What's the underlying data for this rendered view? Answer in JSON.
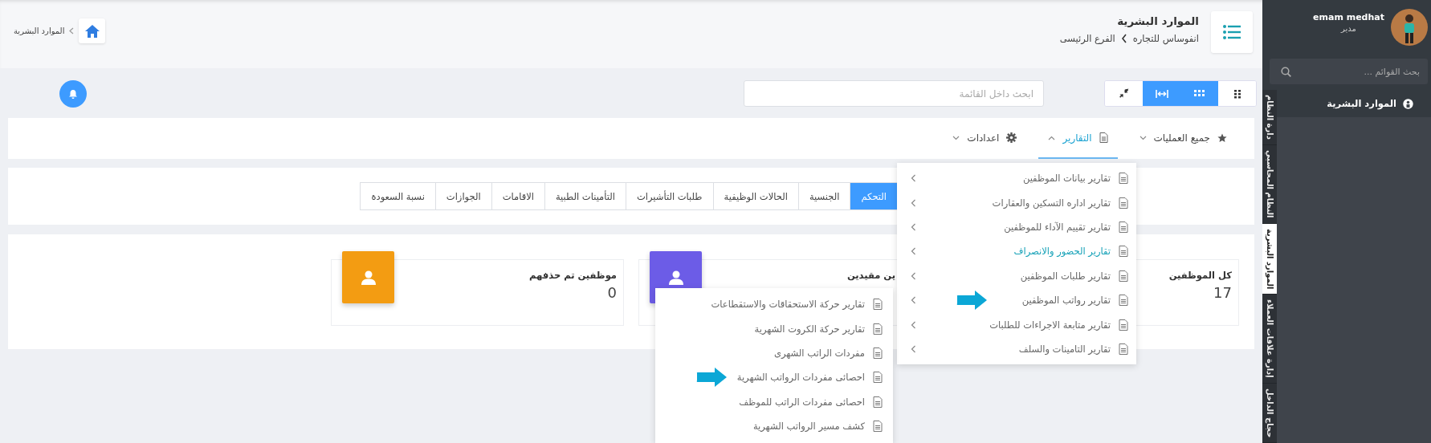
{
  "header": {
    "title": "الموارد البشرية",
    "breadcrumb": [
      "انفوساس للتجاره",
      "الفرع الرئيسى"
    ],
    "home_crumb": "الموارد البشرية"
  },
  "toolbar": {
    "search": {
      "placeholder": "ابحث داخل القائمة"
    },
    "view_buttons": [
      {
        "kind": "grid",
        "selected": false
      },
      {
        "kind": "tiles",
        "selected": true
      },
      {
        "kind": "expand",
        "selected": true
      },
      {
        "kind": "compress",
        "selected": false
      }
    ]
  },
  "menu_bar": [
    {
      "label": "جميع العمليات",
      "kind": "star",
      "selected": false,
      "expanded": false
    },
    {
      "label": "التقارير",
      "kind": "document",
      "selected": true,
      "expanded": true
    },
    {
      "label": "اعدادات",
      "kind": "gear",
      "selected": false,
      "expanded": false
    }
  ],
  "tabs": [
    {
      "label": "التحكم",
      "selected": true
    },
    {
      "label": "الجنسية",
      "selected": false
    },
    {
      "label": "الحالات الوظيفية",
      "selected": false
    },
    {
      "label": "طلبات التأشيرات",
      "selected": false
    },
    {
      "label": "التأمينات الطبية",
      "selected": false
    },
    {
      "label": "الاقامات",
      "selected": false
    },
    {
      "label": "الجوازات",
      "selected": false
    },
    {
      "label": "نسبة السعودة",
      "selected": false
    }
  ],
  "stats": [
    {
      "label": "كل الموظفين",
      "value": "17"
    },
    {
      "label": "ين مقيدين",
      "color": "#6c5ce7"
    },
    {
      "label": "موظفين تم حذفهم",
      "value": "0",
      "color": "#f39c12"
    }
  ],
  "reports_menu": {
    "items": [
      {
        "label": "تقارير بيانات الموظفين",
        "selected": false,
        "marked": false
      },
      {
        "label": "تقارير اداره التسكين والعقارات",
        "selected": false,
        "marked": false
      },
      {
        "label": "تقارير تقييم الآداء للموظفين",
        "selected": false,
        "marked": false
      },
      {
        "label": "تقارير الحضور والانصراف",
        "selected": true,
        "marked": false
      },
      {
        "label": "تقارير طلبات الموظفين",
        "selected": false,
        "marked": false
      },
      {
        "label": "تقارير رواتب الموظفين",
        "selected": false,
        "marked": true
      },
      {
        "label": "تقارير متابعة الاجراءات للطلبات",
        "selected": false,
        "marked": false
      },
      {
        "label": "تقارير التامينات والسلف",
        "selected": false,
        "marked": false
      }
    ]
  },
  "salary_submenu": {
    "items": [
      {
        "label": "تقارير حركة الاستحقاقات والاستقطاعات",
        "selected": false,
        "marked": false
      },
      {
        "label": "تقارير حركة الكروت الشهرية",
        "selected": false,
        "marked": false
      },
      {
        "label": "مفردات الراتب الشهرى",
        "selected": false,
        "marked": false
      },
      {
        "label": "احصائى مفردات الرواتب الشهرية",
        "selected": false,
        "marked": true
      },
      {
        "label": "احصائى مفردات الراتب للموظف",
        "selected": false,
        "marked": false
      },
      {
        "label": "كشف مسير الرواتب الشهرية",
        "selected": false,
        "marked": false
      }
    ]
  },
  "sidebar": {
    "user": {
      "name": "emam medhat",
      "role": "مدير"
    },
    "search": {
      "placeholder": "بحث القوائم ..."
    },
    "items": [
      {
        "label": "الموارد البشرية"
      }
    ],
    "module_tabs": [
      {
        "label": "دارة النظام",
        "selected": false
      },
      {
        "label": "النظام المحاسبي",
        "selected": false
      },
      {
        "label": "الموارد البشرية",
        "selected": true
      },
      {
        "label": "إدارة علاقات العملاء",
        "selected": false
      },
      {
        "label": "حجاج الداخل",
        "selected": false
      }
    ]
  }
}
